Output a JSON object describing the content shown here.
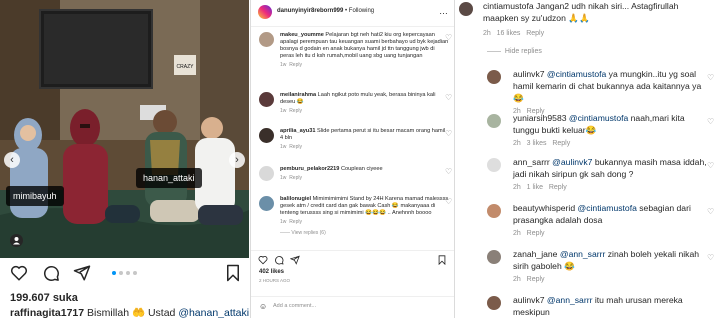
{
  "post": {
    "tags": [
      "mimibayuh",
      "hanan_attaki"
    ],
    "likes": "199.607 suka",
    "caption_user": "raffinagita1717",
    "caption_text": " Bismillah 🤲 Ustad ",
    "caption_mention": "@hanan_attaki",
    "sign_text": "CRAZY"
  },
  "comments_panel": {
    "header_user": "danunyinyir8reborn999",
    "header_follow": "• Following",
    "comments": [
      {
        "user": "makeu_youmme",
        "text": "Pelajaran bgt neh hati2 kiu org kepercayaan apalagi perempuan tau keuangan suami berbahayo ud byk kejadian bosnya d godain en anak bukanya hamil jd ttn tanggung jwb di peras leh itu d ksh rumah,mobil uang sbg uang tunjangan",
        "time": "1w",
        "reply": "Reply"
      },
      {
        "user": "meilanirahma",
        "text": "Laah ngikut poto mulu yeak, berasa bininya kali deseu 😂",
        "time": "1w",
        "reply": "Reply"
      },
      {
        "user": "aprilia_ayu31",
        "text": "Slide pertama perut si itu besar macam orang hamil 4 bln",
        "time": "1w",
        "reply": "Reply"
      },
      {
        "user": "pemburu_pelakor2219",
        "text": "Couplean ciyeee",
        "time": "1w",
        "reply": "Reply"
      },
      {
        "user": "balilonugiel",
        "text": "Mimimimimimi Stand by 24H Karena mamad malessss gesek atm / credit card dan gak bawak Cash 😂 makanyaaa di tenteng terussss sing si mimimimi 😂😂😂 .. Anehnnh boooo",
        "time": "1w",
        "reply": "Reply",
        "view": "View replies (6)"
      }
    ],
    "likes": "402 likes",
    "time": "2 HOURS AGO",
    "add_comment": "Add a comment..."
  },
  "replies_panel": {
    "top": {
      "user": "cintiamustofa",
      "text": "Jangan2 udh nikah siri... Astagfirullah maapken sy zu'udzon 🙏🙏",
      "time": "2h",
      "likes": "16 likes",
      "reply": "Reply"
    },
    "hide_replies": "Hide replies",
    "replies": [
      {
        "user": "aulinvk7",
        "mention": "@cintiamustofa",
        "text": "ya mungkin..itu yg soal hamil kemarin di chat bukannya ada kaitannya ya 😂",
        "time": "2h",
        "reply": "Reply"
      },
      {
        "user": "yuniarsih9583",
        "mention": "@cintiamustofa",
        "text": "naah,mari kita tunggu bukti keluar😂",
        "time": "2h",
        "likes": "3 likes",
        "reply": "Reply"
      },
      {
        "user": "ann_sarrr",
        "mention": "@aulinvk7",
        "text": "bukannya masih masa iddah, jadi nikah siripun gk sah dong ?",
        "time": "2h",
        "likes": "1 like",
        "reply": "Reply"
      },
      {
        "user": "beautywhisperid",
        "mention": "@cintiamustofa",
        "text": "sebagian dari prasangka adalah dosa",
        "time": "2h",
        "reply": "Reply"
      },
      {
        "user": "zanah_jane",
        "mention": "@ann_sarrr",
        "text": "zinah boleh yekali nikah sirih gaboleh 😂",
        "time": "2h",
        "reply": "Reply"
      },
      {
        "user": "aulinvk7",
        "mention": "@ann_sarrr",
        "text": "itu mah urusan mereka meskipun",
        "time": "",
        "reply": ""
      }
    ]
  }
}
